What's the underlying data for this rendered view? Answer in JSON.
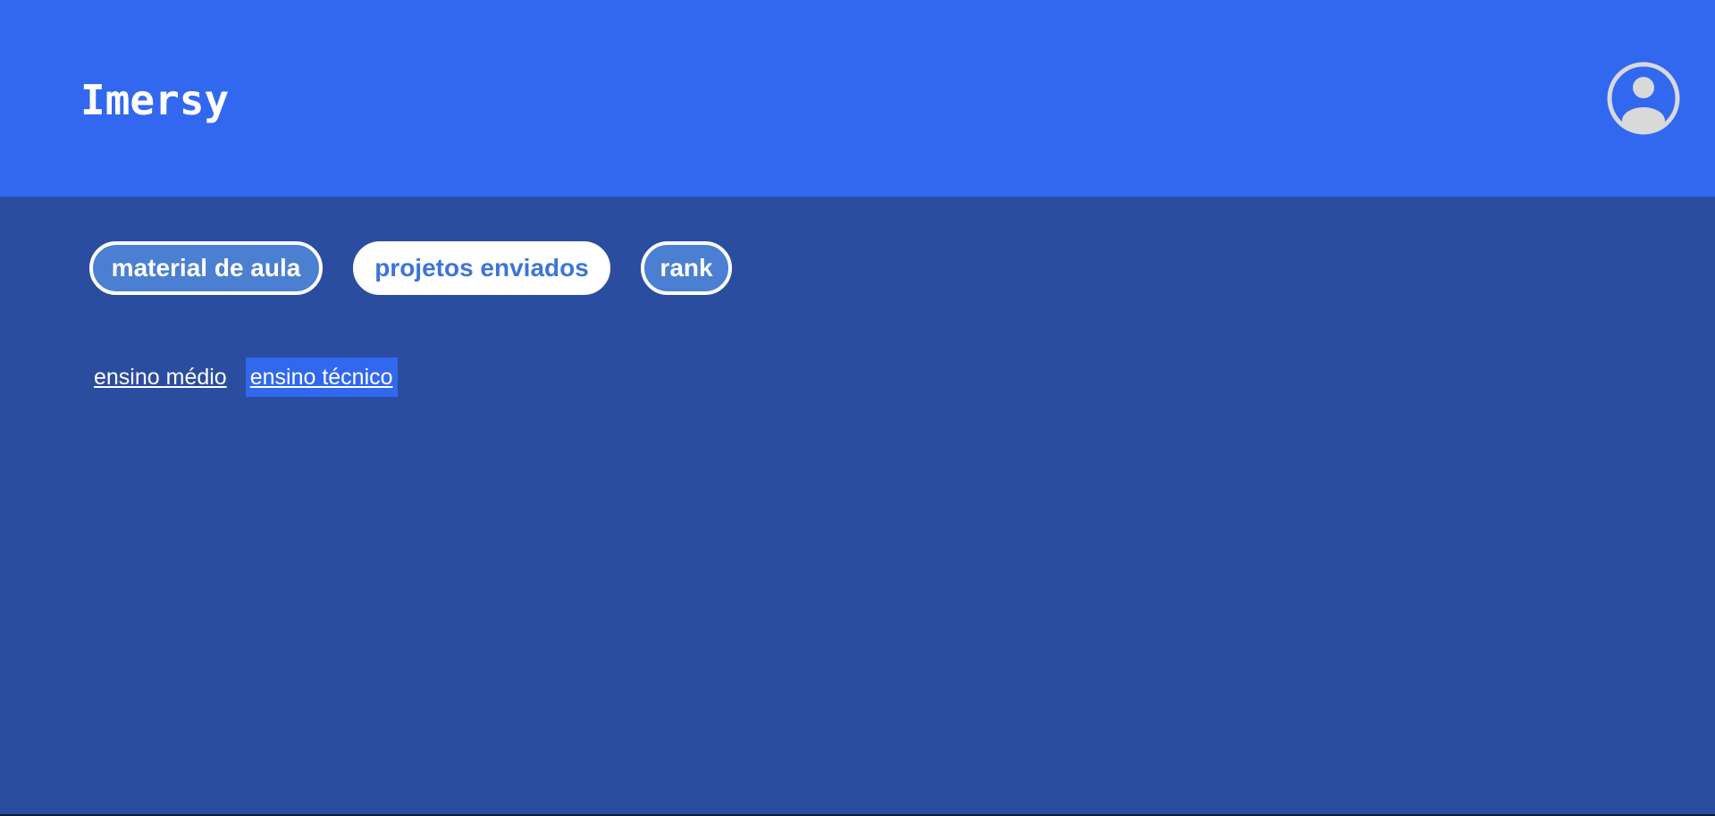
{
  "header": {
    "logo": "Imersy",
    "avatar_icon": "user-circle-icon",
    "background": "#3168ef"
  },
  "tabs": [
    {
      "label": "material de aula",
      "selected": false
    },
    {
      "label": "projetos enviados",
      "selected": true
    },
    {
      "label": "rank",
      "selected": false
    }
  ],
  "sublinks": [
    {
      "label": "ensino médio",
      "active": false
    },
    {
      "label": "ensino técnico",
      "active": true
    }
  ],
  "colors": {
    "page_background": "#2b4d9f",
    "tab_fill": "#4b7fd1",
    "tab_selected_text": "#3d75d6",
    "sublink_active_background": "#3168ef"
  }
}
